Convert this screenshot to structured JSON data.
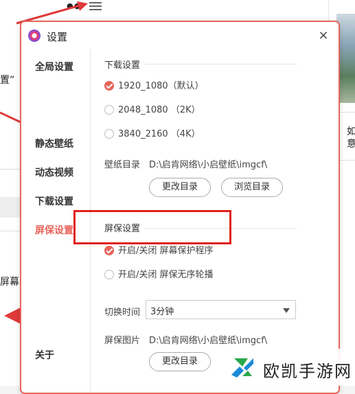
{
  "background": {
    "fragment_quote": "置”",
    "fragment_screen": "屏幕",
    "fragment_right_1": "如",
    "fragment_right_2": "意"
  },
  "dialog": {
    "title": "设置",
    "close_glyph": "×",
    "sidebar": {
      "items": [
        {
          "label": "全局设置",
          "active": false
        },
        {
          "label": "静态壁纸",
          "active": false
        },
        {
          "label": "动态视频",
          "active": false
        },
        {
          "label": "下载设置",
          "active": false
        },
        {
          "label": "屏保设置",
          "active": true
        },
        {
          "label": "关于",
          "active": false
        }
      ]
    },
    "download": {
      "section_title": "下载设置",
      "options": [
        {
          "label": "1920_1080（默认）",
          "checked": true
        },
        {
          "label": "2048_1080  （2K）",
          "checked": false
        },
        {
          "label": "3840_2160  （4K）",
          "checked": false
        }
      ],
      "dir_label": "壁纸目录",
      "dir_value": "D:\\启肯网络\\小启壁纸\\imgcf\\",
      "change_dir_button": "更改目录",
      "browse_dir_button": "浏览目录"
    },
    "screensaver": {
      "section_title": "屏保设置",
      "options": [
        {
          "label": "开启/关闭 屏幕保护程序",
          "checked": true
        },
        {
          "label": "开启/关闭 屏保无序轮播",
          "checked": false
        }
      ],
      "interval_label": "切换时间",
      "interval_value": "3分钟",
      "image_label": "屏保图片",
      "image_value": "D:\\启肯网络\\小启壁纸\\imgcf\\",
      "change_dir_button": "更改目录"
    }
  },
  "watermark": {
    "text": "欧凯手游网"
  },
  "colors": {
    "accent": "#e8645a",
    "highlight_box": "#e0201b",
    "arrow": "#e03a3a"
  }
}
